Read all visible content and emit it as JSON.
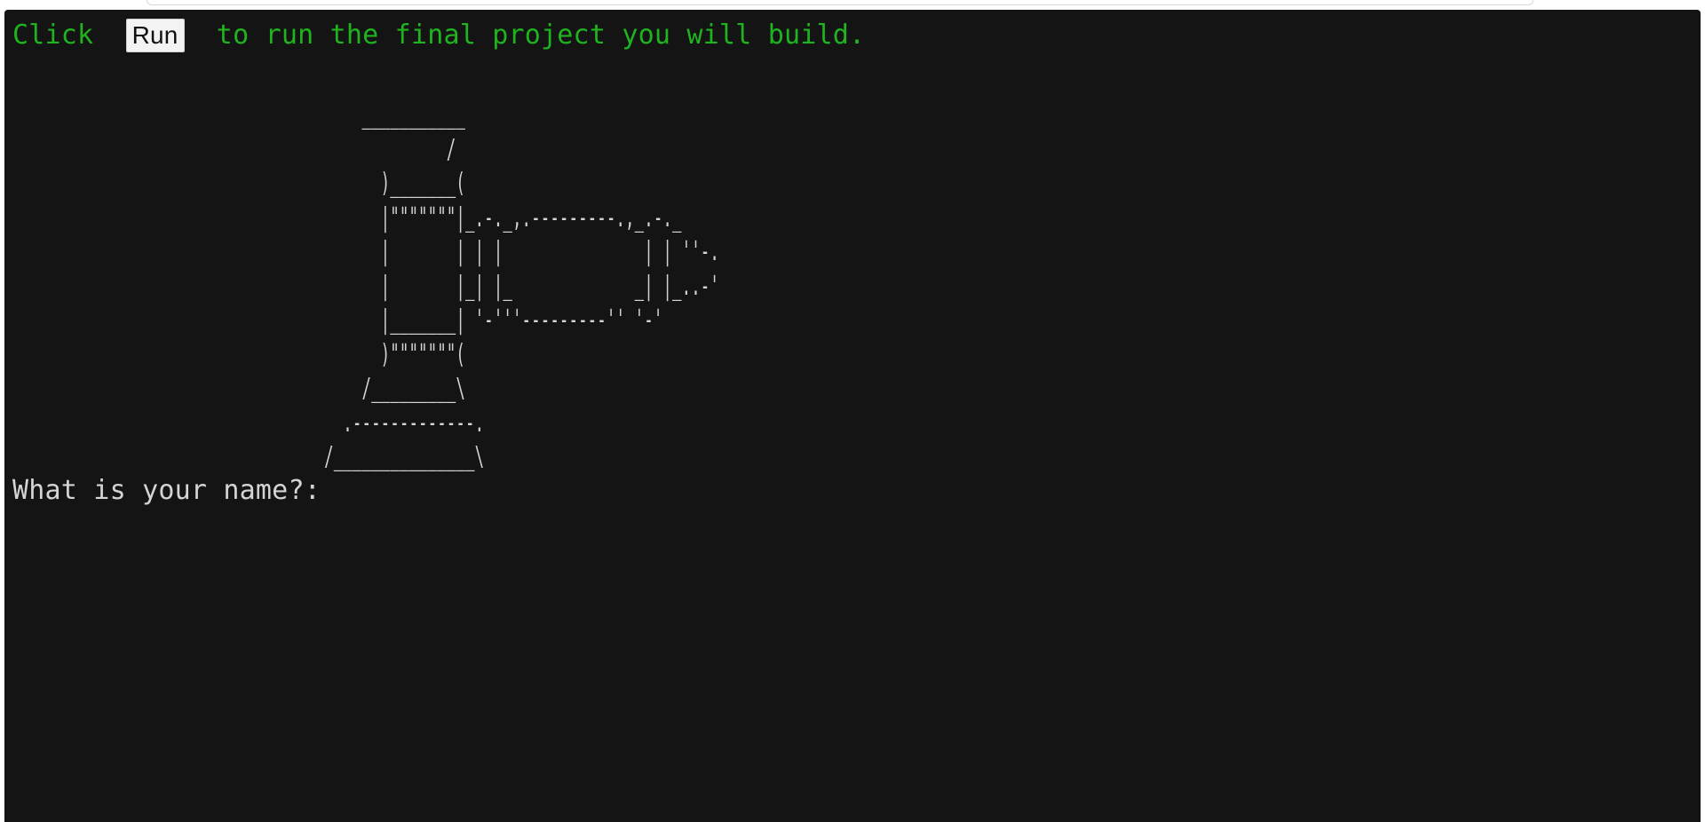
{
  "hint": {
    "prefix": "Click ",
    "run_label": "Run",
    "suffix": " to run the final project you will build."
  },
  "console": {
    "ascii_art": "                                      ___________\n                                               /\n                                        )_______(\n                                        |\"\"\"\"\"\"\"|_.-._,.---------.,_.-._\n                                        |       | | |               | | ''-.\n                                        |       |_| |_             _| |_..-'\n                                        |_______| '-'''---------'' '-'\n                                        )\"\"\"\"\"\"\"(\n                                      /_________\\\n                                    .-------------.\n                                  /_______________\\",
    "prompt": "What is your name?:",
    "input_value": ""
  },
  "colors": {
    "terminal_bg": "#141414",
    "hint_text": "#1fb31f",
    "console_text": "#d4d4d4",
    "run_button_bg": "#f3f3f3"
  }
}
